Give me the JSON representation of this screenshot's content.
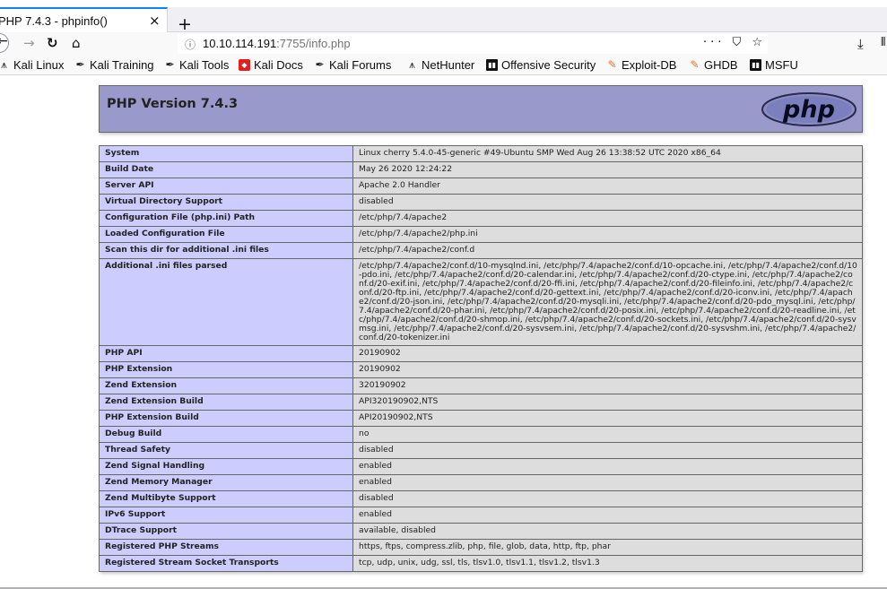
{
  "browser": {
    "tab_title": "PHP 7.4.3 - phpinfo()",
    "tab_close": "×",
    "new_tab": "+",
    "url_host": "10.10.114.191",
    "url_rest": ":7755/info.php",
    "url_actions": "··· ⛉ ☆",
    "bookmarks": [
      {
        "label": "Kali Linux",
        "icon": "kali-dragon-icon"
      },
      {
        "label": "Kali Training",
        "icon": "kali-pen-icon"
      },
      {
        "label": "Kali Tools",
        "icon": "kali-pen-icon"
      },
      {
        "label": "Kali Docs",
        "icon": "red-doc-icon"
      },
      {
        "label": "Kali Forums",
        "icon": "kali-pen-icon"
      },
      {
        "label": "NetHunter",
        "icon": "kali-dragon-icon"
      },
      {
        "label": "Offensive Security",
        "icon": "offsec-icon"
      },
      {
        "label": "Exploit-DB",
        "icon": "exploitdb-icon"
      },
      {
        "label": "GHDB",
        "icon": "exploitdb-icon"
      },
      {
        "label": "MSFU",
        "icon": "offsec-icon"
      }
    ]
  },
  "phpinfo": {
    "version_title": "PHP Version 7.4.3",
    "logo_text": "php",
    "rows": [
      {
        "key": "System",
        "value": "Linux cherry 5.4.0-45-generic #49-Ubuntu SMP Wed Aug 26 13:38:52 UTC 2020 x86_64"
      },
      {
        "key": "Build Date",
        "value": "May 26 2020 12:24:22"
      },
      {
        "key": "Server API",
        "value": "Apache 2.0 Handler"
      },
      {
        "key": "Virtual Directory Support",
        "value": "disabled"
      },
      {
        "key": "Configuration File (php.ini) Path",
        "value": "/etc/php/7.4/apache2"
      },
      {
        "key": "Loaded Configuration File",
        "value": "/etc/php/7.4/apache2/php.ini"
      },
      {
        "key": "Scan this dir for additional .ini files",
        "value": "/etc/php/7.4/apache2/conf.d"
      },
      {
        "key": "Additional .ini files parsed",
        "value": "/etc/php/7.4/apache2/conf.d/10-mysqlnd.ini, /etc/php/7.4/apache2/conf.d/10-opcache.ini, /etc/php/7.4/apache2/conf.d/10-pdo.ini, /etc/php/7.4/apache2/conf.d/20-calendar.ini, /etc/php/7.4/apache2/conf.d/20-ctype.ini, /etc/php/7.4/apache2/conf.d/20-exif.ini, /etc/php/7.4/apache2/conf.d/20-ffi.ini, /etc/php/7.4/apache2/conf.d/20-fileinfo.ini, /etc/php/7.4/apache2/conf.d/20-ftp.ini, /etc/php/7.4/apache2/conf.d/20-gettext.ini, /etc/php/7.4/apache2/conf.d/20-iconv.ini, /etc/php/7.4/apache2/conf.d/20-json.ini, /etc/php/7.4/apache2/conf.d/20-mysqli.ini, /etc/php/7.4/apache2/conf.d/20-pdo_mysql.ini, /etc/php/7.4/apache2/conf.d/20-phar.ini, /etc/php/7.4/apache2/conf.d/20-posix.ini, /etc/php/7.4/apache2/conf.d/20-readline.ini, /etc/php/7.4/apache2/conf.d/20-shmop.ini, /etc/php/7.4/apache2/conf.d/20-sockets.ini, /etc/php/7.4/apache2/conf.d/20-sysvmsg.ini, /etc/php/7.4/apache2/conf.d/20-sysvsem.ini, /etc/php/7.4/apache2/conf.d/20-sysvshm.ini, /etc/php/7.4/apache2/conf.d/20-tokenizer.ini"
      },
      {
        "key": "PHP API",
        "value": "20190902"
      },
      {
        "key": "PHP Extension",
        "value": "20190902"
      },
      {
        "key": "Zend Extension",
        "value": "320190902"
      },
      {
        "key": "Zend Extension Build",
        "value": "API320190902,NTS"
      },
      {
        "key": "PHP Extension Build",
        "value": "API20190902,NTS"
      },
      {
        "key": "Debug Build",
        "value": "no"
      },
      {
        "key": "Thread Safety",
        "value": "disabled"
      },
      {
        "key": "Zend Signal Handling",
        "value": "enabled"
      },
      {
        "key": "Zend Memory Manager",
        "value": "enabled"
      },
      {
        "key": "Zend Multibyte Support",
        "value": "disabled"
      },
      {
        "key": "IPv6 Support",
        "value": "enabled"
      },
      {
        "key": "DTrace Support",
        "value": "available, disabled"
      },
      {
        "key": "Registered PHP Streams",
        "value": "https, ftps, compress.zlib, php, file, glob, data, http, ftp, phar"
      },
      {
        "key": "Registered Stream Socket Transports",
        "value": "tcp, udp, unix, udg, ssl, tls, tlsv1.0, tlsv1.1, tlsv1.2, tlsv1.3"
      }
    ]
  }
}
